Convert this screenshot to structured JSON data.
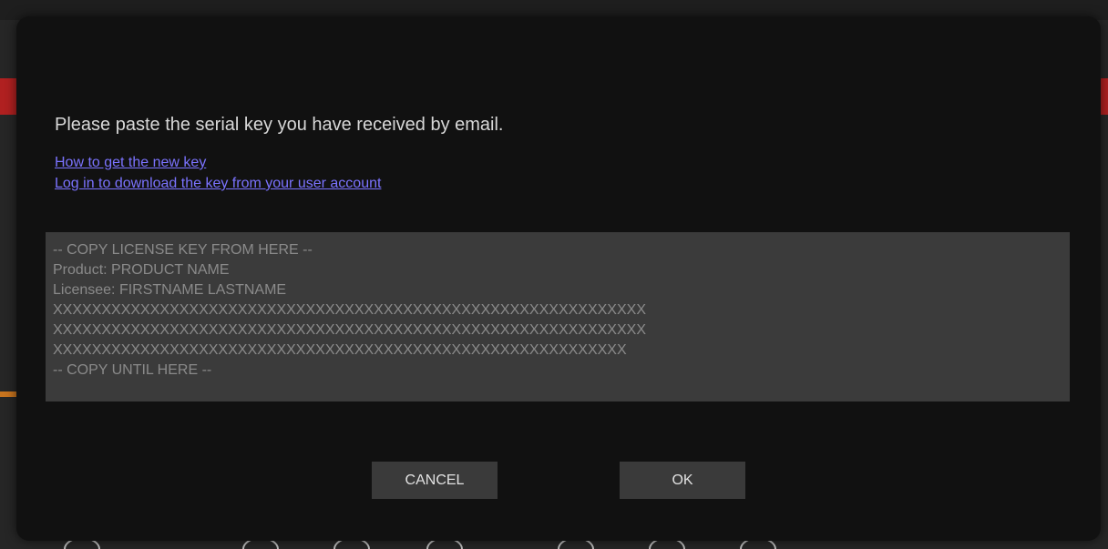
{
  "dialog": {
    "message": "Please paste the serial key you have received by email.",
    "links": {
      "how_to_get_key": "How to get the new key",
      "login_download": "Log in to download the key from your user account"
    },
    "license_key_text": "-- COPY LICENSE KEY FROM HERE --\nProduct: PRODUCT NAME\nLicensee: FIRSTNAME LASTNAME\nXXXXXXXXXXXXXXXXXXXXXXXXXXXXXXXXXXXXXXXXXXXXXXXXXXXXXXXXXXXXX\nXXXXXXXXXXXXXXXXXXXXXXXXXXXXXXXXXXXXXXXXXXXXXXXXXXXXXXXXXXXXX\nXXXXXXXXXXXXXXXXXXXXXXXXXXXXXXXXXXXXXXXXXXXXXXXXXXXXXXXXXXX\n-- COPY UNTIL HERE --",
    "buttons": {
      "cancel": "CANCEL",
      "ok": "OK"
    }
  },
  "colors": {
    "dialog_bg": "#111111",
    "link": "#7b73ff",
    "field_bg": "#3b3b3b",
    "button_bg": "#3a3a3a",
    "background_accent_red": "#b02020"
  }
}
